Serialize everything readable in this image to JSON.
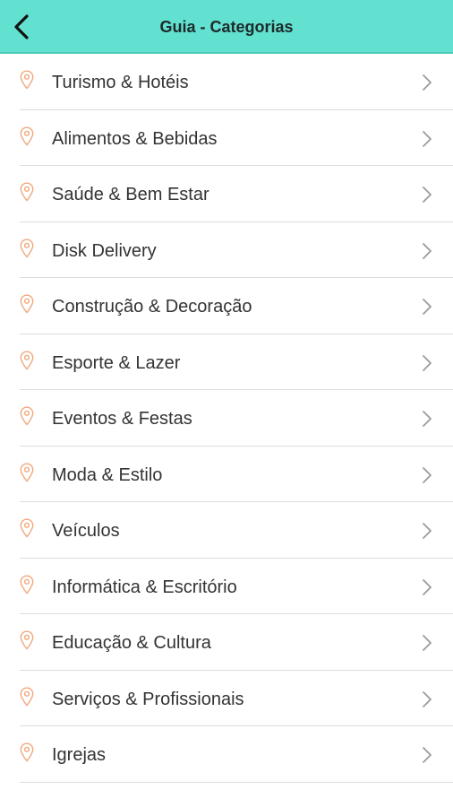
{
  "header": {
    "title": "Guia - Categorias",
    "back_icon": "back-arrow-icon"
  },
  "colors": {
    "header_bg": "#62e0d0",
    "pin": "#f2a77c",
    "chevron": "#9a9a9a",
    "divider": "#dcdcdc",
    "text": "#333333"
  },
  "categories": [
    {
      "label": "Turismo & Hotéis"
    },
    {
      "label": "Alimentos & Bebidas"
    },
    {
      "label": "Saúde & Bem Estar"
    },
    {
      "label": "Disk Delivery"
    },
    {
      "label": "Construção & Decoração"
    },
    {
      "label": "Esporte & Lazer"
    },
    {
      "label": "Eventos & Festas"
    },
    {
      "label": "Moda & Estilo"
    },
    {
      "label": "Veículos"
    },
    {
      "label": "Informática & Escritório"
    },
    {
      "label": "Educação & Cultura"
    },
    {
      "label": "Serviços & Profissionais"
    },
    {
      "label": "Igrejas"
    }
  ]
}
